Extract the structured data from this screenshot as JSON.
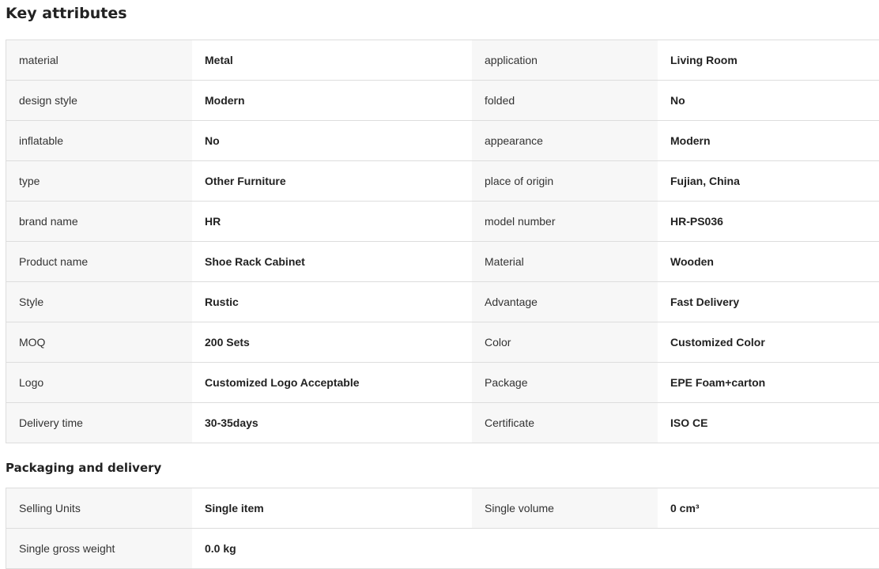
{
  "key_attributes": {
    "title": "Key attributes",
    "rows": [
      {
        "l1": "material",
        "v1": "Metal",
        "l2": "application",
        "v2": "Living Room"
      },
      {
        "l1": "design style",
        "v1": "Modern",
        "l2": "folded",
        "v2": "No"
      },
      {
        "l1": "inflatable",
        "v1": "No",
        "l2": "appearance",
        "v2": "Modern"
      },
      {
        "l1": "type",
        "v1": "Other Furniture",
        "l2": "place of origin",
        "v2": "Fujian, China"
      },
      {
        "l1": "brand name",
        "v1": "HR",
        "l2": "model number",
        "v2": "HR-PS036"
      },
      {
        "l1": "Product name",
        "v1": "Shoe Rack Cabinet",
        "l2": "Material",
        "v2": "Wooden"
      },
      {
        "l1": "Style",
        "v1": "Rustic",
        "l2": "Advantage",
        "v2": "Fast Delivery"
      },
      {
        "l1": "MOQ",
        "v1": "200 Sets",
        "l2": "Color",
        "v2": "Customized Color"
      },
      {
        "l1": "Logo",
        "v1": "Customized Logo Acceptable",
        "l2": "Package",
        "v2": "EPE Foam+carton"
      },
      {
        "l1": "Delivery time",
        "v1": "30-35days",
        "l2": "Certificate",
        "v2": "ISO CE"
      }
    ]
  },
  "packaging": {
    "title": "Packaging and delivery",
    "rows": [
      {
        "l1": "Selling Units",
        "v1": "Single item",
        "l2": "Single volume",
        "v2": "0 cm³"
      },
      {
        "l1": "Single gross weight",
        "v1": "0.0 kg"
      }
    ]
  },
  "colors": {
    "label_bg": "#f7f7f7",
    "border": "#dddddd",
    "text": "#222222"
  }
}
